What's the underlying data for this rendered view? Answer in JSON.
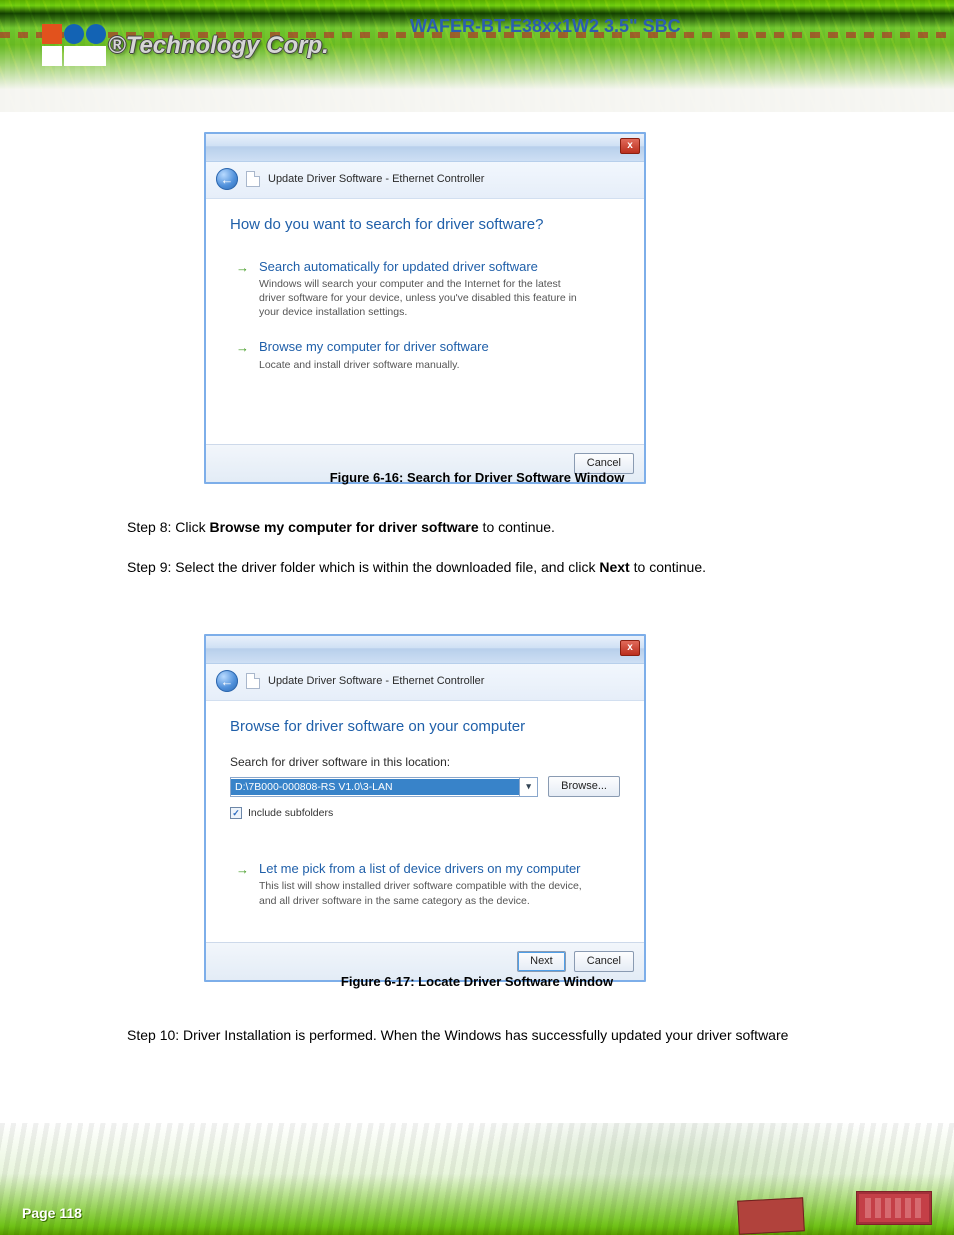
{
  "brand": {
    "logo_text": "®Technology Corp."
  },
  "doc_title": "WAFER-BT-E38xx1W2 3.5\" SBC",
  "dialog1": {
    "breadcrumb": "Update Driver Software - Ethernet Controller",
    "heading": "How do you want to search for driver software?",
    "option_auto": {
      "title": "Search automatically for updated driver software",
      "desc": "Windows will search your computer and the Internet for the latest driver software for your device, unless you've disabled this feature in your device installation settings."
    },
    "option_browse": {
      "title": "Browse my computer for driver software",
      "desc": "Locate and install driver software manually."
    },
    "cancel": "Cancel"
  },
  "caption1": "Figure 6-16: Search for Driver Software Window",
  "step8_pre": "Step 8:  Click ",
  "step8_bold": "Browse my computer for driver software",
  "step8_post": " to continue.",
  "step9_pre": "Step 9:  Select the driver folder which is within the downloaded file, and click ",
  "step9_bold": "Next",
  "step9_post": " to continue.",
  "dialog2": {
    "breadcrumb": "Update Driver Software - Ethernet Controller",
    "heading": "Browse for driver software on your computer",
    "search_label": "Search for driver software in this location:",
    "path_value": "D:\\7B000-000808-RS V1.0\\3-LAN",
    "browse": "Browse...",
    "include_subfolders": "Include subfolders",
    "option_pick": {
      "title": "Let me pick from a list of device drivers on my computer",
      "desc": "This list will show installed driver software compatible with the device, and all driver software in the same category as the device."
    },
    "next": "Next",
    "cancel": "Cancel"
  },
  "caption2": "Figure 6-17: Locate Driver Software Window",
  "step10": "Step 10:  Driver Installation is performed. When the Windows has successfully updated your driver software",
  "page_num": "Page 118"
}
